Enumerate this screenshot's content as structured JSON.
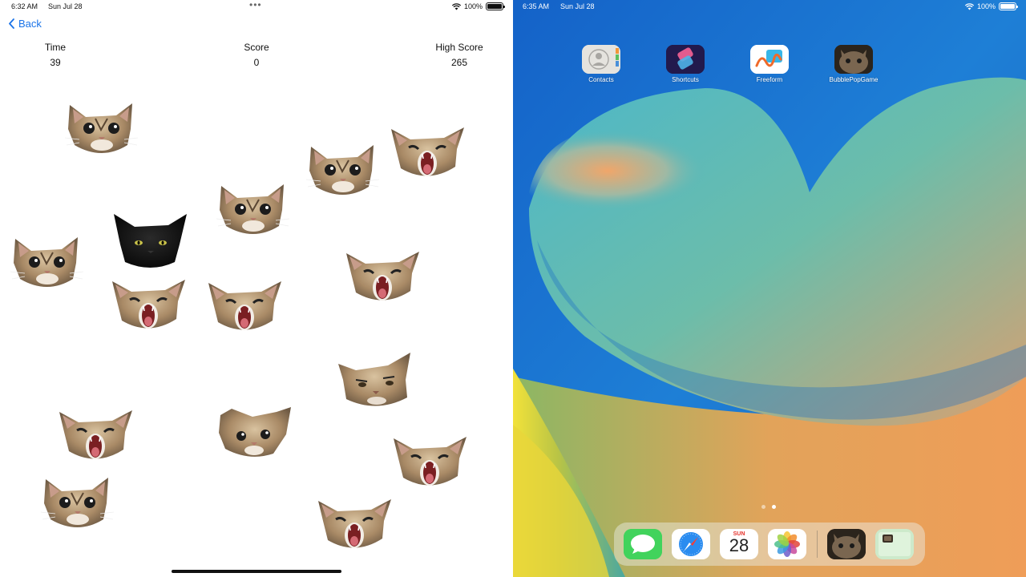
{
  "left_status": {
    "time": "6:32 AM",
    "date": "Sun Jul 28",
    "battery": "100%"
  },
  "nav": {
    "back_label": "Back"
  },
  "stats": {
    "time_label": "Time",
    "time_value": "39",
    "score_label": "Score",
    "score_value": "0",
    "high_label": "High Score",
    "high_value": "265"
  },
  "bubbles": [
    {
      "kind": "calm"
    },
    {
      "kind": "calm"
    },
    {
      "kind": "calm"
    },
    {
      "kind": "calm"
    },
    {
      "kind": "calm"
    },
    {
      "kind": "calm"
    },
    {
      "kind": "black"
    },
    {
      "kind": "scream"
    },
    {
      "kind": "scream"
    },
    {
      "kind": "scream"
    },
    {
      "kind": "scream"
    },
    {
      "kind": "scream"
    },
    {
      "kind": "scream"
    },
    {
      "kind": "scream"
    },
    {
      "kind": "grumpy"
    },
    {
      "kind": "tilted"
    }
  ],
  "right_status": {
    "time": "6:35 AM",
    "date": "Sun Jul 28",
    "battery": "100%"
  },
  "home_apps": [
    {
      "name": "Contacts",
      "icon": "contacts-icon"
    },
    {
      "name": "Shortcuts",
      "icon": "shortcuts-icon"
    },
    {
      "name": "Freeform",
      "icon": "freeform-icon"
    },
    {
      "name": "BubblePopGame",
      "icon": "cat-app-icon"
    }
  ],
  "dock": {
    "apps": [
      "messages-icon",
      "safari-icon",
      "calendar-icon",
      "photos-icon",
      "cat-app-icon",
      "recent-app-icon"
    ],
    "calendar_day": "SUN",
    "calendar_date": "28"
  },
  "colors": {
    "link": "#1a73e8",
    "game_bg": "#ffffff"
  }
}
